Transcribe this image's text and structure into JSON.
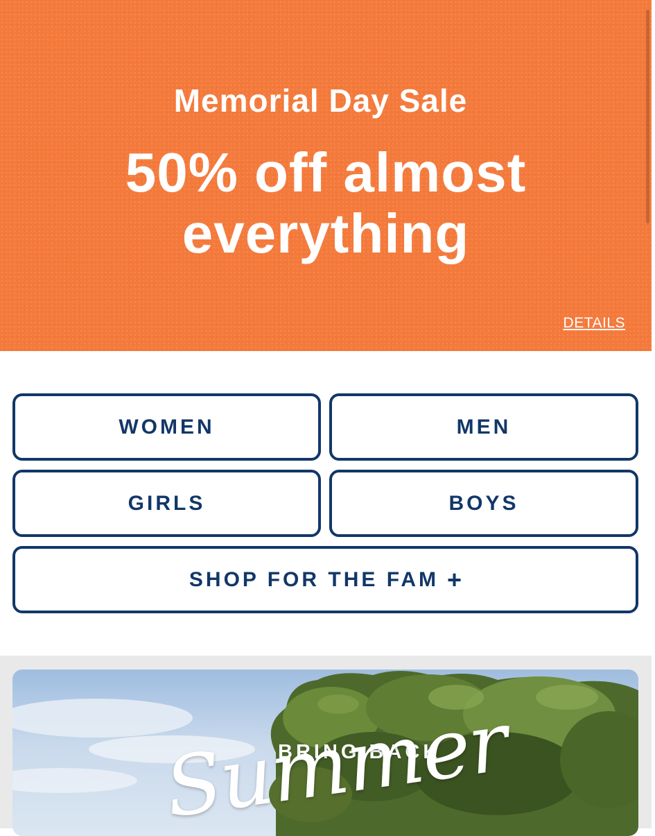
{
  "promo": {
    "subtitle": "Memorial Day Sale",
    "headline": "50% off almost everything",
    "details_link": "DETAILS",
    "background_color": "#f47a3c"
  },
  "categories": {
    "women": "WOMEN",
    "men": "MEN",
    "girls": "GIRLS",
    "boys": "BOYS",
    "family": "SHOP FOR THE FAM",
    "family_icon": "plus-icon",
    "accent_color": "#123768"
  },
  "summer": {
    "bring_back": "BRING BACK",
    "script_title": "Summer"
  }
}
